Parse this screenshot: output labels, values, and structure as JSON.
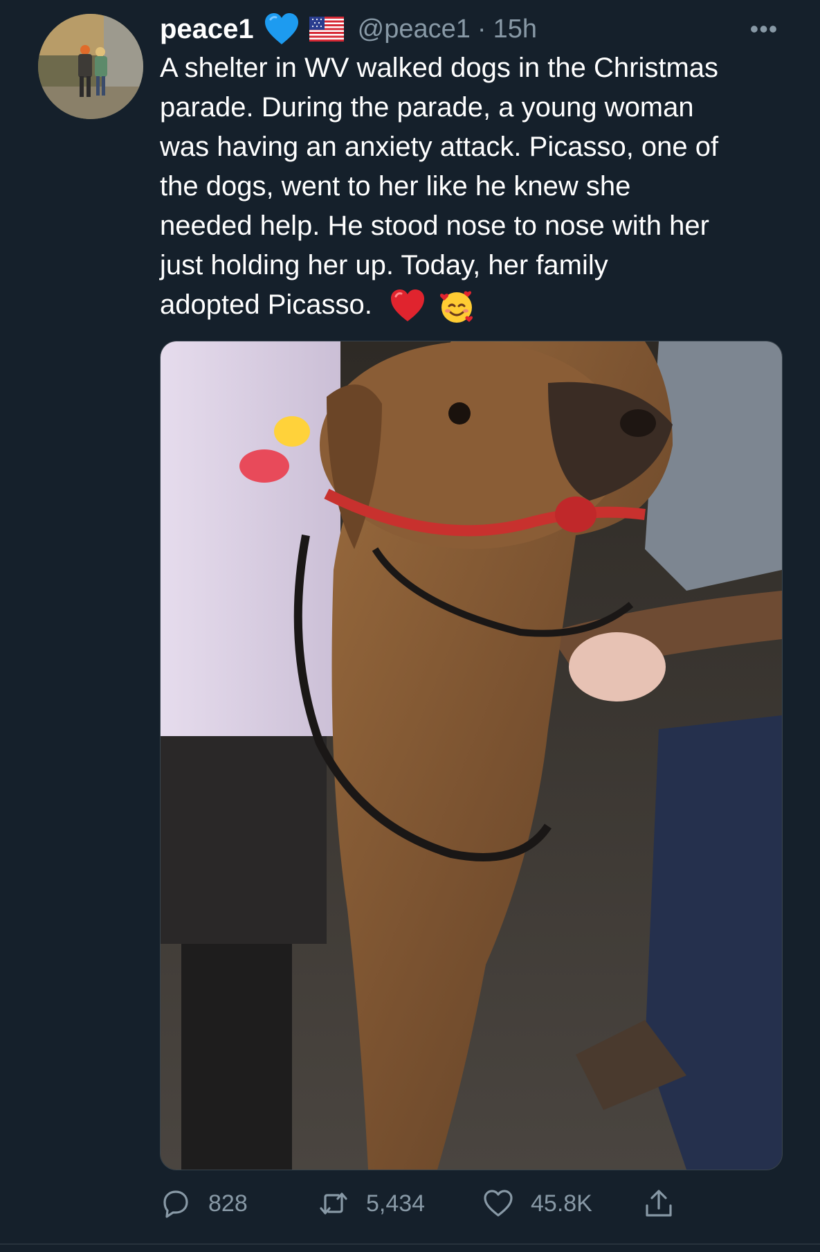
{
  "tweet": {
    "display_name": "peace1",
    "handle": "@peace1",
    "separator": "·",
    "time": "15h",
    "more_label": "•••",
    "text_lines": [
      "A shelter in WV walked dogs in the Christmas",
      "parade. During the parade, a young woman",
      "was having an anxiety attack. Picasso, one of",
      "the dogs, went to her like he knew she",
      "needed help. He stood nose to nose with her",
      "just holding her up. Today, her family",
      "adopted Picasso."
    ],
    "trailing_emojis": [
      "red-heart-emoji",
      "smiling-face-with-hearts-emoji"
    ],
    "badge_icons": [
      "blue-heart-icon",
      "us-flag-icon"
    ]
  },
  "actions": {
    "reply_count": "828",
    "retweet_count": "5,434",
    "like_count": "45.8K"
  },
  "colors": {
    "background": "#15202b",
    "secondary_text": "#8899a6",
    "border": "#38444d",
    "heart_blue": "#1d9bf0"
  }
}
